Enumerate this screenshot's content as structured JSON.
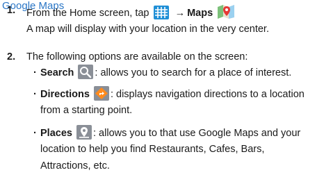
{
  "heading": "Google Maps",
  "steps": [
    {
      "number": "1.",
      "prefix": "From the Home screen, tap",
      "arrow": "→",
      "app_name": "Maps",
      "line2": "A map will display with your location in the very center."
    },
    {
      "number": "2.",
      "text": "The following options are available on the screen:"
    }
  ],
  "options": [
    {
      "label": "Search",
      "icon": "search-icon",
      "lines": [
        ": allows you to search for a place of interest."
      ]
    },
    {
      "label": "Directions",
      "icon": "directions-icon",
      "lines": [
        ": displays navigation directions to a location",
        "from a starting point."
      ]
    },
    {
      "label": "Places",
      "icon": "places-icon",
      "lines": [
        ": allows you to that use Google Maps and your",
        "location to help you find Restaurants, Cafes, Bars,",
        "Attractions, etc."
      ]
    }
  ],
  "colors": {
    "heading": "#2a76c6",
    "icon_bg": "#8a8f97",
    "apps_grid": "#1f8fd6",
    "directions_diamond": "#ff8a1c"
  }
}
